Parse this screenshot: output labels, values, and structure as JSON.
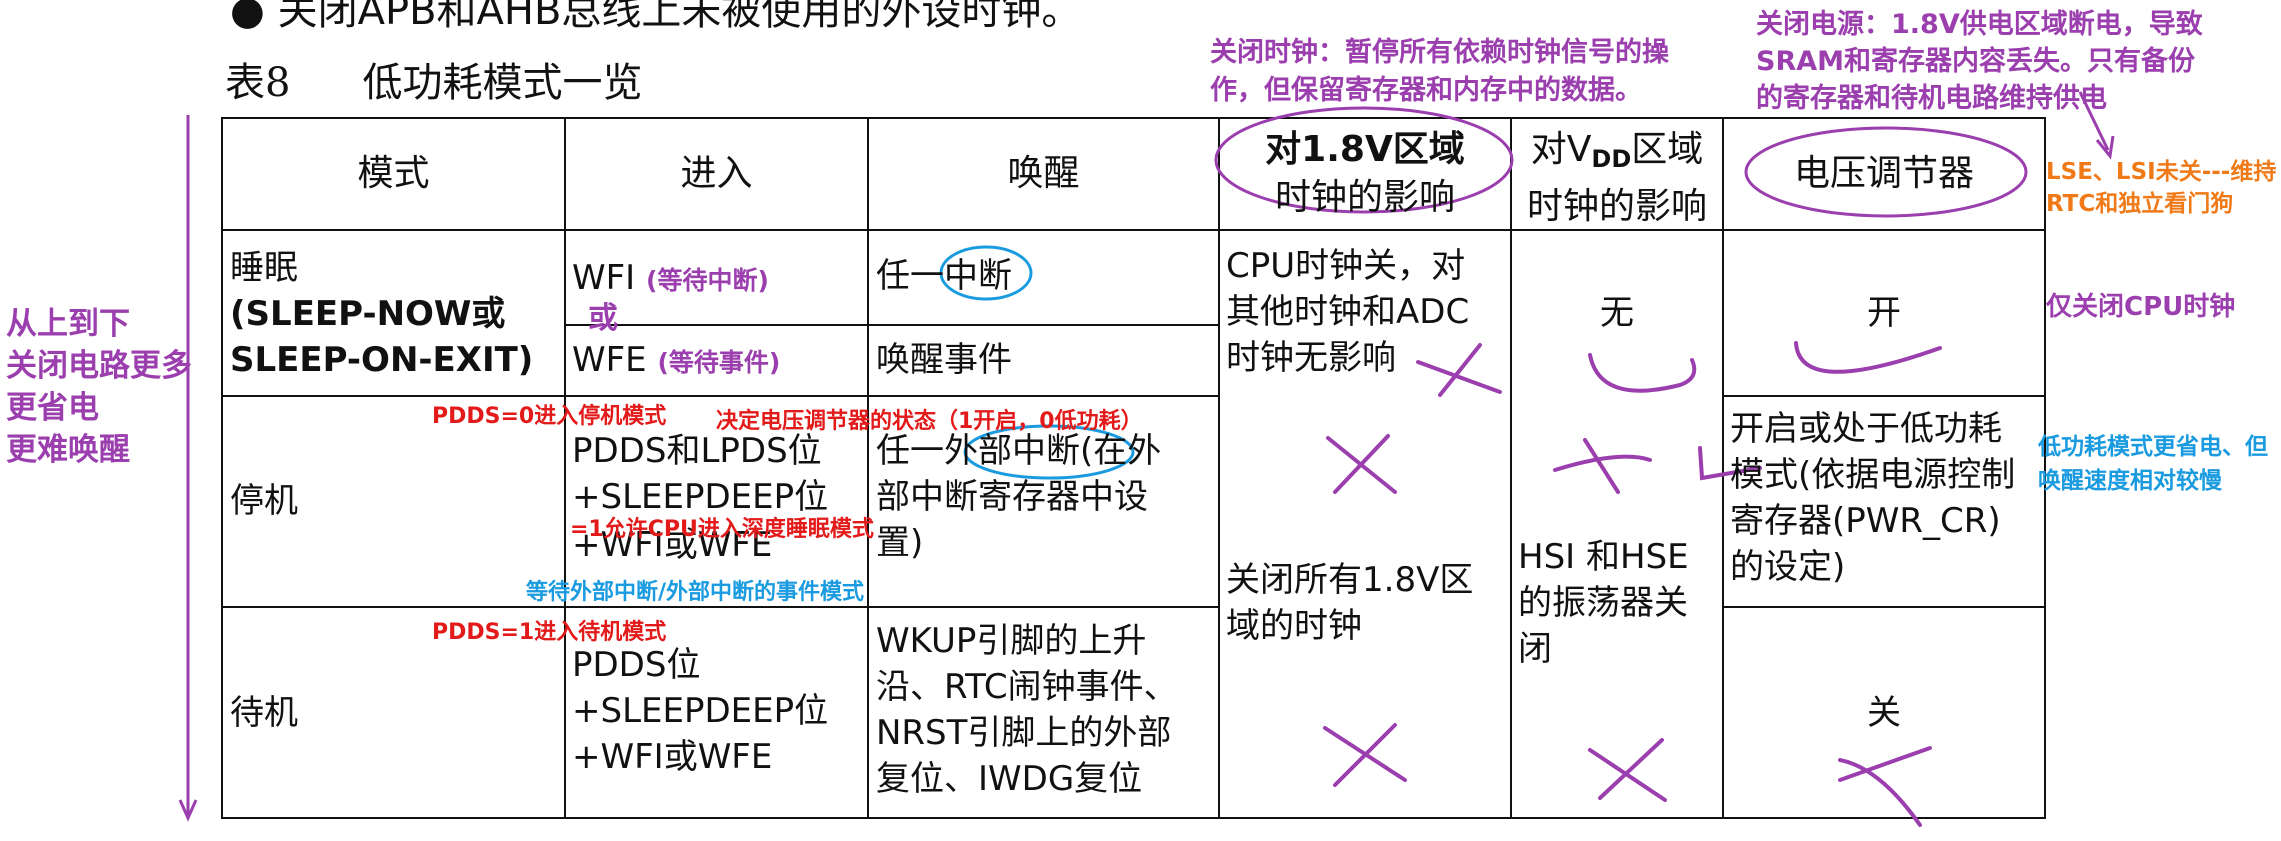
{
  "top_fragment": "● 关闭APB和AHB总线上未被使用的外设时钟。",
  "caption": {
    "table_no": "表8",
    "title": "低功耗模式一览"
  },
  "headers": {
    "mode": "模式",
    "enter": "进入",
    "wakeup": "唤醒",
    "effect_18v_line1": "对1.8V区域",
    "effect_18v_line2": "时钟的影响",
    "effect_vdd_line1_pre": "对V",
    "effect_vdd_sub": "DD",
    "effect_vdd_line1_post": "区域",
    "effect_vdd_line2": "时钟的影响",
    "regulator": "电压调节器"
  },
  "rows": {
    "sleep": {
      "mode_line1": "睡眠",
      "mode_line2": "(SLEEP-NOW或",
      "mode_line3": "SLEEP-ON-EXIT)",
      "enter_wfi": "WFI",
      "enter_wfi_note": "(等待中断)",
      "enter_or": "或",
      "enter_wfe": "WFE",
      "enter_wfe_note": "(等待事件)",
      "wake_wfi": "任一中断",
      "wake_wfe": "唤醒事件",
      "effect_18v_line1": "CPU时钟关，对",
      "effect_18v_line2": "其他时钟和ADC",
      "effect_18v_line3": "时钟无影响",
      "effect_vdd": "无",
      "regulator": "开"
    },
    "stop": {
      "mode": "停机",
      "enter_line1": "PDDS和LPDS位",
      "enter_line2": "+SLEEPDEEP位",
      "enter_line3": "+WFI或WFE",
      "wake_line1": "任一外部中断(在外",
      "wake_line2": "部中断寄存器中设",
      "wake_line3": "置)",
      "regulator_line1": "开启或处于低功耗",
      "regulator_line2": "模式(依据电源控制",
      "regulator_line3": "寄存器(PWR_CR)",
      "regulator_line4": "的设定)"
    },
    "stop_standby_shared": {
      "effect_18v_line1": "关闭所有1.8V区",
      "effect_18v_line2": "域的时钟",
      "effect_vdd_line1": "HSI 和HSE",
      "effect_vdd_line2": "的振荡器关",
      "effect_vdd_line3": "闭"
    },
    "standby": {
      "mode": "待机",
      "enter_line1": "PDDS位",
      "enter_line2": "+SLEEPDEEP位",
      "enter_line3": "+WFI或WFE",
      "wake_line1": "WKUP引脚的上升",
      "wake_line2": "沿、RTC闹钟事件、",
      "wake_line3": "NRST引脚上的外部",
      "wake_line4": "复位、IWDG复位",
      "regulator": "关"
    }
  },
  "annotations": {
    "left_line1": "从上到下",
    "left_line2": "关闭电路更多",
    "left_line3": "更省电",
    "left_line4": "更难唤醒",
    "clock_off_line1": "关闭时钟：暂停所有依赖时钟信号的操",
    "clock_off_line2": "作，但保留寄存器和内存中的数据。",
    "power_off_line1": "关闭电源：1.8V供电区域断电，导致",
    "power_off_line2": "SRAM和寄存器内容丢失。只有备份",
    "power_off_line3": "的寄存器和待机电路维持供电",
    "lse_line1": "LSE、LSI未关---维持",
    "lse_line2": "RTC和独立看门狗",
    "cpu_only": "仅关闭CPU时钟",
    "lowpower_line1": "低功耗模式更省电、但",
    "lowpower_line2": "唤醒速度相对较慢",
    "pdds0": "PDDS=0进入停机模式",
    "regulator_state": "决定电压调节器的状态（1开启，0低功耗）",
    "sleepdeep": "=1允许CPU进入深度睡眠模式",
    "ext_event": "等待外部中断/外部中断的事件模式",
    "pdds1": "PDDS=1进入待机模式"
  },
  "colors": {
    "purple": "#9b3fae",
    "red": "#e31a1a",
    "blue": "#1a9be0",
    "orange": "#f07a18",
    "grid": "#111111"
  }
}
